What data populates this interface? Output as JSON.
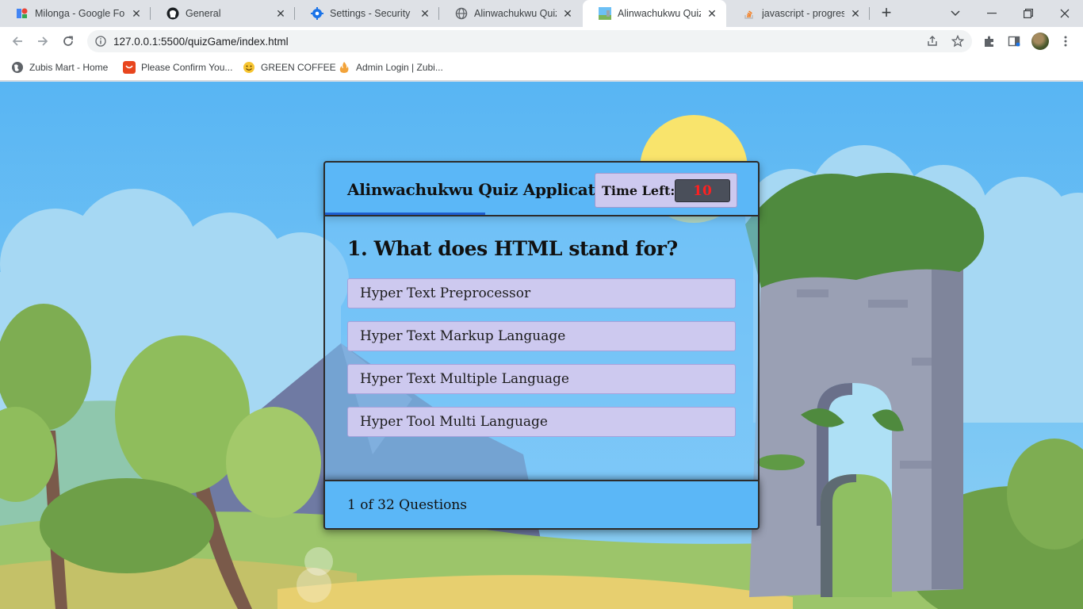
{
  "browser": {
    "tabs": [
      {
        "title": "Milonga - Google Fon",
        "icon": "google-fonts-icon",
        "active": false
      },
      {
        "title": "General",
        "icon": "github-icon",
        "active": false
      },
      {
        "title": "Settings - Security",
        "icon": "gear-icon",
        "active": false
      },
      {
        "title": "Alinwachukwu Quiz Ap",
        "icon": "globe-icon",
        "active": false
      },
      {
        "title": "Alinwachukwu Quiz Ap",
        "icon": "landscape-thumbnail-icon",
        "active": true
      },
      {
        "title": "javascript - progress b",
        "icon": "stackoverflow-icon",
        "active": false
      }
    ],
    "url": "127.0.0.1:5500/quizGame/index.html",
    "bookmarks": [
      {
        "label": "Zubis Mart - Home",
        "icon": "globe-icon"
      },
      {
        "label": "Please Confirm You...",
        "icon": "shopping-bag-icon"
      },
      {
        "label": "GREEN COFFEE",
        "icon": "smiley-icon"
      },
      {
        "label": "Admin Login | Zubi...",
        "icon": "flame-icon"
      }
    ]
  },
  "quiz": {
    "app_title": "Alinwachukwu Quiz Application",
    "timer_label": "Time Left:",
    "timer_value": "10",
    "question": "1. What does HTML stand for?",
    "options": [
      "Hyper Text Preprocessor",
      "Hyper Text Markup Language",
      "Hyper Text Multiple Language",
      "Hyper Tool Multi Language"
    ],
    "question_count": "1 of 32 Questions",
    "progress_fraction": 0.37
  },
  "colors": {
    "sky": "#5ab6f2",
    "panel": "#5bb7f7",
    "option_bg": "#cdc9ef",
    "timer_text": "#ff2020",
    "progress_bar": "#1e5fd1"
  }
}
